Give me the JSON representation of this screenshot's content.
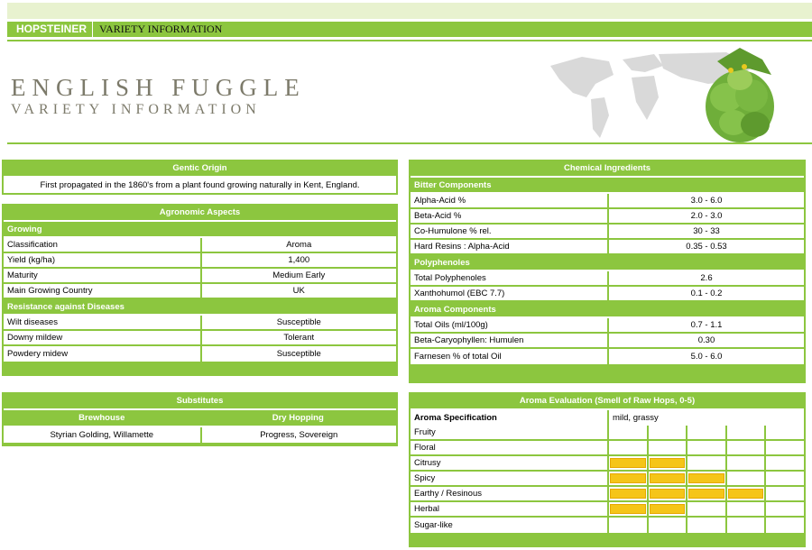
{
  "header": {
    "brand": "HOPSTEINER",
    "section": "VARIETY INFORMATION"
  },
  "hero": {
    "title": "ENGLISH FUGGLE",
    "subtitle": "VARIETY INFORMATION"
  },
  "origin": {
    "title": "Gentic Origin",
    "text": "First propagated in the 1860's from a plant found growing naturally in Kent, England."
  },
  "agronomic": {
    "title": "Agronomic Aspects",
    "growing_label": "Growing",
    "growing": [
      {
        "label": "Classification",
        "value": "Aroma"
      },
      {
        "label": "Yield (kg/ha)",
        "value": "1,400"
      },
      {
        "label": "Maturity",
        "value": "Medium Early"
      },
      {
        "label": "Main Growing Country",
        "value": "UK"
      }
    ],
    "resistance_label": "Resistance against Diseases",
    "resistance": [
      {
        "label": "Wilt diseases",
        "value": "Susceptible"
      },
      {
        "label": "Downy mildew",
        "value": "Tolerant"
      },
      {
        "label": "Powdery midew",
        "value": "Susceptible"
      }
    ]
  },
  "substitutes": {
    "title": "Substitutes",
    "brewhouse_label": "Brewhouse",
    "dryhopping_label": "Dry Hopping",
    "brewhouse": "Styrian Golding, Willamette",
    "dryhopping": "Progress, Sovereign"
  },
  "chemical": {
    "title": "Chemical Ingredients",
    "bitter_label": "Bitter Components",
    "bitter": [
      {
        "label": "Alpha-Acid %",
        "value": "3.0 - 6.0"
      },
      {
        "label": "Beta-Acid %",
        "value": "2.0 - 3.0"
      },
      {
        "label": "Co-Humulone % rel.",
        "value": "30 - 33"
      },
      {
        "label": "Hard Resins : Alpha-Acid",
        "value": "0.35 - 0.53"
      }
    ],
    "poly_label": "Polyphenoles",
    "poly": [
      {
        "label": "Total Polyphenoles",
        "value": "2.6"
      },
      {
        "label": "Xanthohumol (EBC 7.7)",
        "value": "0.1 - 0.2"
      }
    ],
    "aroma_label": "Aroma Components",
    "aroma": [
      {
        "label": "Total Oils (ml/100g)",
        "value": "0.7 - 1.1"
      },
      {
        "label": "Beta-Caryophyllen: Humulen",
        "value": "0.30"
      },
      {
        "label": "Farnesen % of total Oil",
        "value": "5.0 - 6.0"
      }
    ]
  },
  "aroma_eval": {
    "title": "Aroma Evaluation (Smell of Raw Hops, 0-5)",
    "spec_label": "Aroma Specification",
    "spec_value": "mild, grassy",
    "scale_max": 5,
    "bar_color": "#f5c518",
    "rows": [
      {
        "label": "Fruity",
        "score": 0
      },
      {
        "label": "Floral",
        "score": 0
      },
      {
        "label": "Citrusy",
        "score": 2
      },
      {
        "label": "Spicy",
        "score": 3
      },
      {
        "label": "Earthy / Resinous",
        "score": 4
      },
      {
        "label": "Herbal",
        "score": 2
      },
      {
        "label": "Sugar-like",
        "score": 0
      }
    ]
  }
}
